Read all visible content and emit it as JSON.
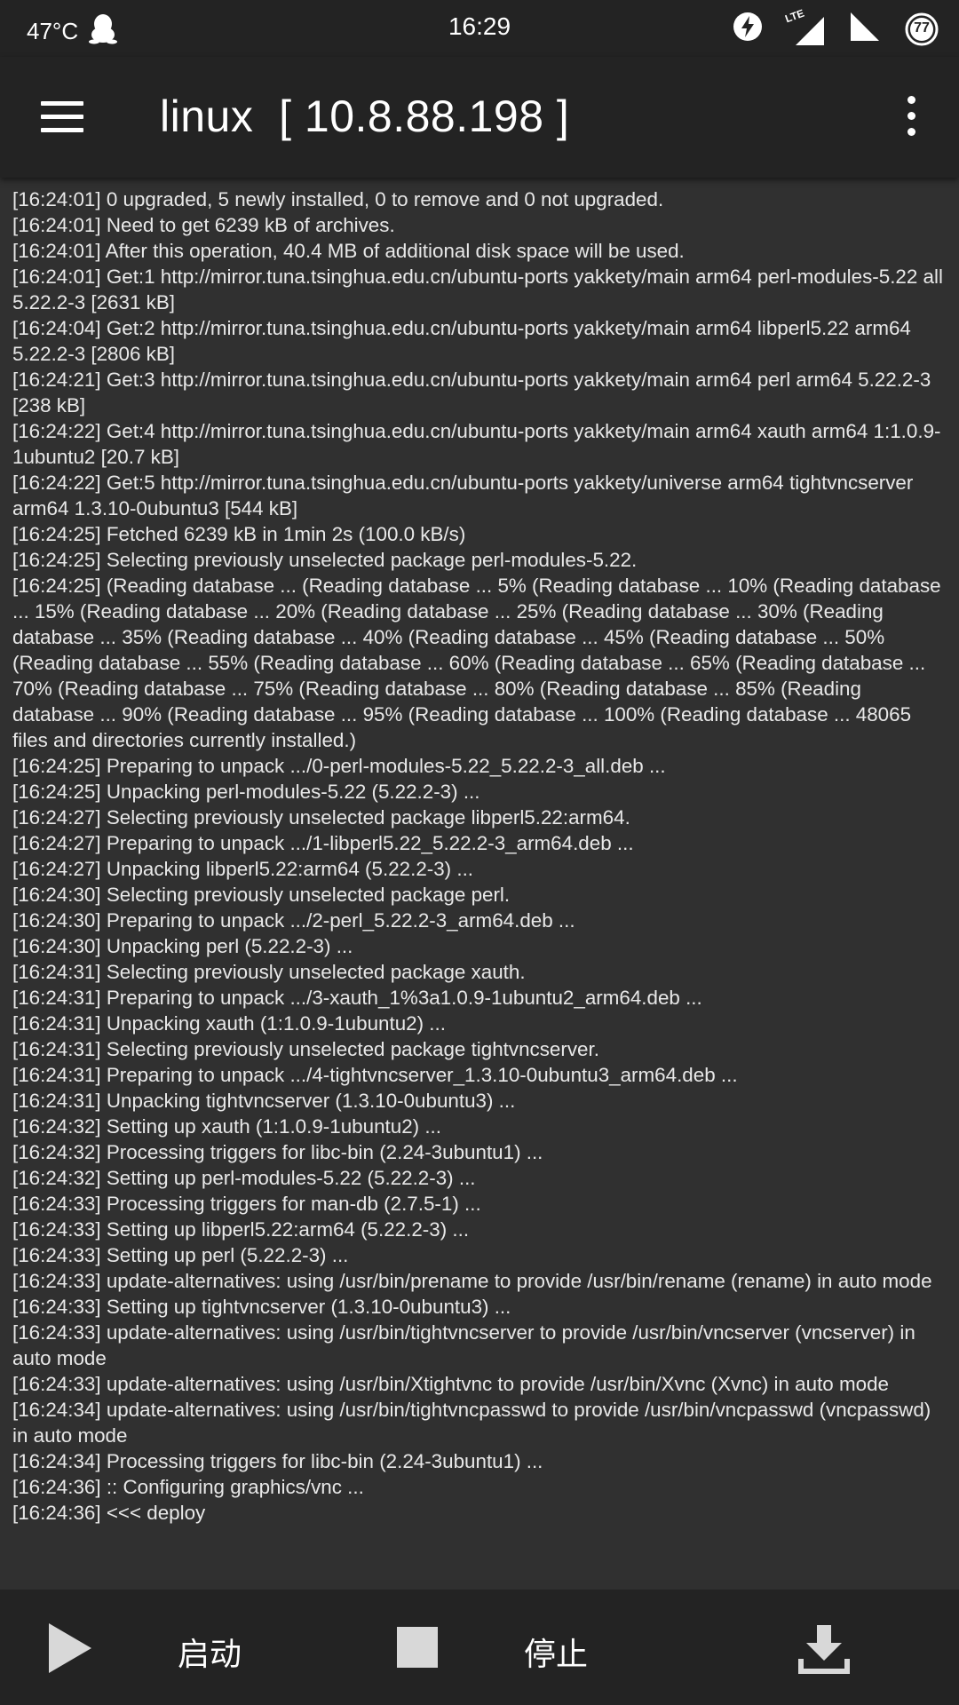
{
  "status_bar": {
    "temperature": "47°C",
    "time": "16:29",
    "lte_label": "LTE",
    "battery_level": "77",
    "icons": [
      "qq-penguin-icon",
      "data-saver-icon",
      "lte-signal-icon",
      "signal-icon",
      "battery-icon"
    ]
  },
  "app_bar": {
    "title": "linux  [ 10.8.88.198 ]"
  },
  "log_lines": [
    "[16:24:01] 0 upgraded, 5 newly installed, 0 to remove and 0 not upgraded.",
    "[16:24:01] Need to get 6239 kB of archives.",
    "[16:24:01] After this operation, 40.4 MB of additional disk space will be used.",
    "[16:24:01] Get:1 http://mirror.tuna.tsinghua.edu.cn/ubuntu-ports yakkety/main arm64 perl-modules-5.22 all 5.22.2-3 [2631 kB]",
    "[16:24:04] Get:2 http://mirror.tuna.tsinghua.edu.cn/ubuntu-ports yakkety/main arm64 libperl5.22 arm64 5.22.2-3 [2806 kB]",
    "[16:24:21] Get:3 http://mirror.tuna.tsinghua.edu.cn/ubuntu-ports yakkety/main arm64 perl arm64 5.22.2-3 [238 kB]",
    "[16:24:22] Get:4 http://mirror.tuna.tsinghua.edu.cn/ubuntu-ports yakkety/main arm64 xauth arm64 1:1.0.9-1ubuntu2 [20.7 kB]",
    "[16:24:22] Get:5 http://mirror.tuna.tsinghua.edu.cn/ubuntu-ports yakkety/universe arm64 tightvncserver arm64 1.3.10-0ubuntu3 [544 kB]",
    "[16:24:25] Fetched 6239 kB in 1min 2s (100.0 kB/s)",
    "[16:24:25] Selecting previously unselected package perl-modules-5.22.",
    "[16:24:25] (Reading database ...  (Reading database ... 5% (Reading database ... 10% (Reading database ... 15% (Reading database ... 20% (Reading database ... 25% (Reading database ... 30% (Reading database ... 35% (Reading database ... 40% (Reading database ... 45% (Reading database ... 50% (Reading database ... 55% (Reading database ... 60% (Reading database ... 65% (Reading database ... 70% (Reading database ... 75% (Reading database ... 80% (Reading database ... 85% (Reading database ... 90% (Reading database ... 95% (Reading database ... 100% (Reading database ... 48065 files and directories currently installed.)",
    "[16:24:25] Preparing to unpack .../0-perl-modules-5.22_5.22.2-3_all.deb ...",
    "[16:24:25] Unpacking perl-modules-5.22 (5.22.2-3) ...",
    "[16:24:27] Selecting previously unselected package libperl5.22:arm64.",
    "[16:24:27] Preparing to unpack .../1-libperl5.22_5.22.2-3_arm64.deb ...",
    "[16:24:27] Unpacking libperl5.22:arm64 (5.22.2-3) ...",
    "[16:24:30] Selecting previously unselected package perl.",
    "[16:24:30] Preparing to unpack .../2-perl_5.22.2-3_arm64.deb ...",
    "[16:24:30] Unpacking perl (5.22.2-3) ...",
    "[16:24:31] Selecting previously unselected package xauth.",
    "[16:24:31] Preparing to unpack .../3-xauth_1%3a1.0.9-1ubuntu2_arm64.deb ...",
    "[16:24:31] Unpacking xauth (1:1.0.9-1ubuntu2) ...",
    "[16:24:31] Selecting previously unselected package tightvncserver.",
    "[16:24:31] Preparing to unpack .../4-tightvncserver_1.3.10-0ubuntu3_arm64.deb ...",
    "[16:24:31] Unpacking tightvncserver (1.3.10-0ubuntu3) ...",
    "[16:24:32] Setting up xauth (1:1.0.9-1ubuntu2) ...",
    "[16:24:32] Processing triggers for libc-bin (2.24-3ubuntu1) ...",
    "[16:24:32] Setting up perl-modules-5.22 (5.22.2-3) ...",
    "[16:24:33] Processing triggers for man-db (2.7.5-1) ...",
    "[16:24:33] Setting up libperl5.22:arm64 (5.22.2-3) ...",
    "[16:24:33] Setting up perl (5.22.2-3) ...",
    "[16:24:33] update-alternatives: using /usr/bin/prename to provide /usr/bin/rename (rename) in auto mode",
    "[16:24:33] Setting up tightvncserver (1.3.10-0ubuntu3) ...",
    "[16:24:33] update-alternatives: using /usr/bin/tightvncserver to provide /usr/bin/vncserver (vncserver) in auto mode",
    "[16:24:33] update-alternatives: using /usr/bin/Xtightvnc to provide /usr/bin/Xvnc (Xvnc) in auto mode",
    "[16:24:34] update-alternatives: using /usr/bin/tightvncpasswd to provide /usr/bin/vncpasswd (vncpasswd) in auto mode",
    "[16:24:34] Processing triggers for libc-bin (2.24-3ubuntu1) ...",
    "[16:24:36] :: Configuring graphics/vnc ...",
    "[16:24:36] <<< deploy"
  ],
  "bottom_bar": {
    "start_label": "启动",
    "stop_label": "停止",
    "icons": [
      "play-icon",
      "stop-icon",
      "download-icon"
    ]
  },
  "colors": {
    "bar_background": "#232323",
    "log_background": "#303030",
    "log_text": "#e8e8e8",
    "icon_gray": "#d8d8d8"
  }
}
